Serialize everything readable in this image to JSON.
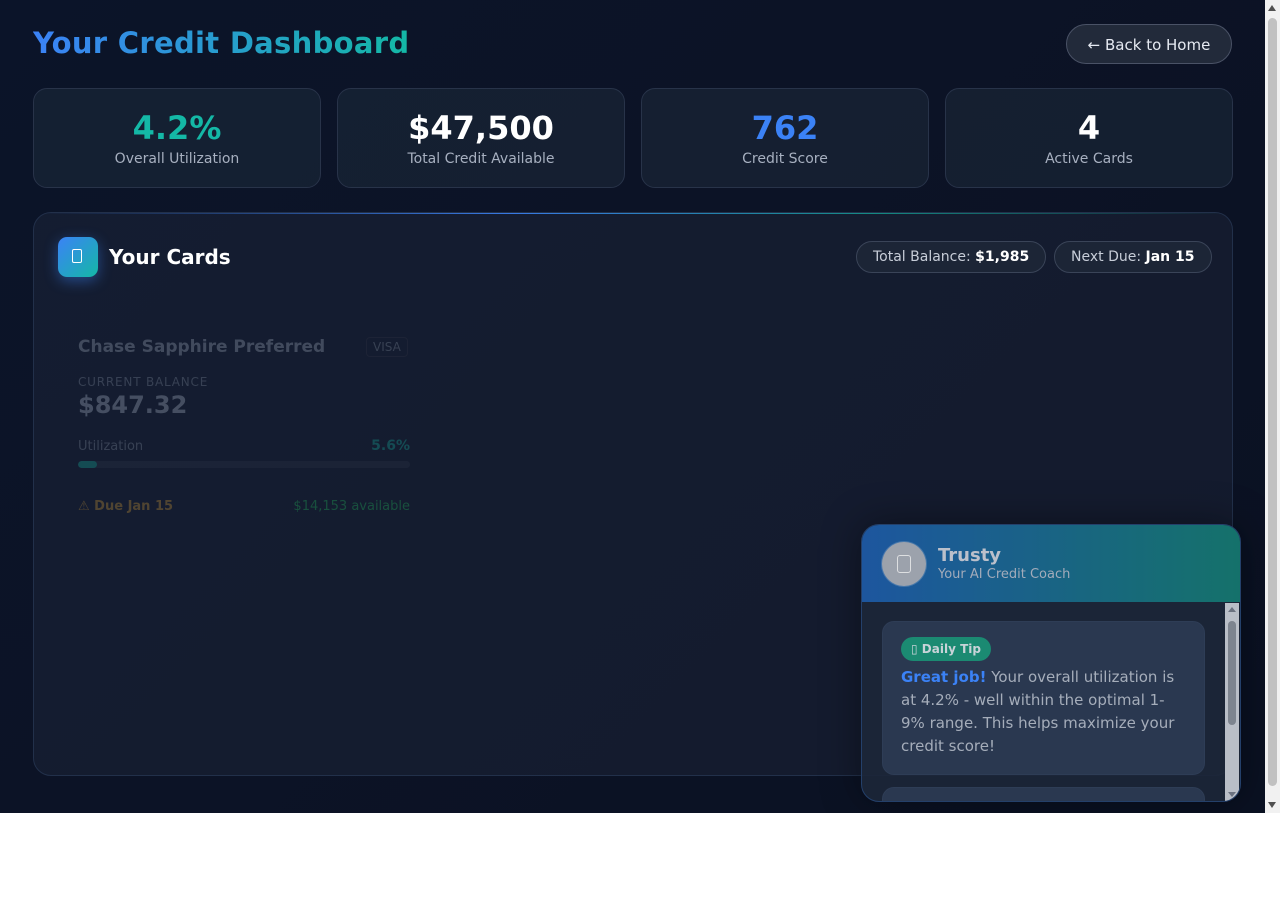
{
  "header": {
    "title": "Your Credit Dashboard",
    "back_label": "← Back to Home"
  },
  "stats": [
    {
      "value": "4.2%",
      "label": "Overall Utilization",
      "color": "#14b8a6"
    },
    {
      "value": "$47,500",
      "label": "Total Credit Available",
      "color": "#ffffff"
    },
    {
      "value": "762",
      "label": "Credit Score",
      "color": "#3b82f6"
    },
    {
      "value": "4",
      "label": "Active Cards",
      "color": "#ffffff"
    }
  ],
  "cards_section": {
    "icon": "credit-card-icon",
    "title": "Your Cards",
    "total_balance_label": "Total Balance:",
    "total_balance_value": "$1,985",
    "next_due_label": "Next Due:",
    "next_due_value": "Jan 15",
    "cards": [
      {
        "name": "Chase Sapphire Preferred",
        "network": "VISA",
        "balance_label": "CURRENT BALANCE",
        "balance": "$847.32",
        "utilization_label": "Utilization",
        "utilization": "5.6%",
        "utilization_fraction": 0.056,
        "due": "⚠ Due Jan 15",
        "available": "$14,153 available"
      }
    ]
  },
  "chat": {
    "avatar_icon": "robot-icon",
    "name": "Trusty",
    "subtitle": "Your AI Credit Coach",
    "tip": {
      "badge_icon": "lightbulb-icon",
      "badge": "Daily Tip",
      "highlight": "Great job!",
      "text": " Your overall utilization is at 4.2% - well within the optimal 1-9% range. This helps maximize your credit score!"
    }
  },
  "colors": {
    "accent_blue": "#3b82f6",
    "accent_teal": "#14b8a6",
    "background": "#0b1429"
  }
}
